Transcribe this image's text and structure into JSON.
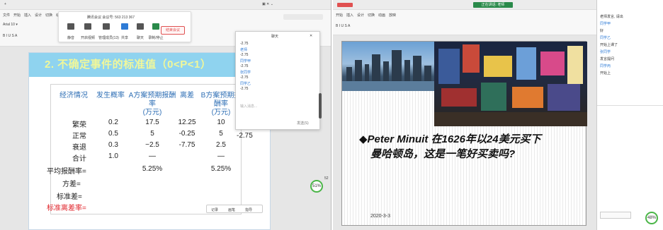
{
  "left": {
    "meeting": {
      "id_label": "腾讯会议  会议号: 563 213 367",
      "buttons": [
        "静音",
        "开启视频",
        "管理成员(13)",
        "共享",
        "聊天",
        "录制/停止",
        "更多"
      ],
      "end_label": "结束会议"
    },
    "slide": {
      "title": "2. 不确定事件的标准值（0<P<1）",
      "headers": {
        "h1": "经济情况",
        "h2": "发生概率",
        "h3_l1": "A方案预期报酬",
        "h3_l2": "率",
        "h3_l3": "(万元)",
        "h4": "离差",
        "h5_l1": "B方案预期报",
        "h5_l2": "酬率",
        "h5_l3": "(万元)"
      },
      "rows": [
        {
          "c1": "繁荣",
          "c2": "0.2",
          "c3": "17.5",
          "c4": "12.25",
          "c5": "10",
          "c6": ""
        },
        {
          "c1": "正常",
          "c2": "0.5",
          "c3": "5",
          "c4": "-0.25",
          "c5": "5",
          "c6": ""
        },
        {
          "c1": "衰退",
          "c2": "0.3",
          "c3": "−2.5",
          "c4": "-7.75",
          "c5": "2.5",
          "c6": "-2.75"
        },
        {
          "c1": "合计",
          "c2": "1.0",
          "c3": "—",
          "c4": "",
          "c5": "—",
          "c6": ""
        }
      ],
      "summary": {
        "avg_label": "平均报酬率=",
        "avg_a": "5.25%",
        "avg_b": "5.25%",
        "var_label": "方差=",
        "std_label": "标准差=",
        "cv_label": "标准离差率="
      }
    },
    "chat": {
      "title": "聊天",
      "lines": [
        "-2.75",
        "老师",
        "-2.75",
        "同学甲",
        "-2.75",
        "张同学",
        "-2.75",
        "同学乙",
        "-2.75"
      ],
      "input_placeholder": "输入消息...",
      "send_label": "发送(S)"
    },
    "badge": "51%",
    "badge_side": "52",
    "toolstrip": [
      "记录",
      "画笔",
      "指导"
    ]
  },
  "right": {
    "titlebar_badge": "正在讲话: 老师",
    "slide": {
      "text_line1": "◆Peter Minuit 在1626年以24美元买下",
      "text_line2": "曼哈顿岛，这是一笔好买卖吗?",
      "date": "2020-3-3"
    },
    "side": {
      "lines": [
        "老师发言, 请出",
        "同学甲",
        "好",
        "同学乙",
        "开始上课了",
        "张同学",
        "发言提问",
        "同学丙",
        "开始上"
      ],
      "badge": "48%"
    }
  },
  "colors": {
    "title_bar": "#8fd3ef",
    "title_text": "#f0f79a",
    "header_text": "#2f6fb5",
    "accent_red": "#e0232a",
    "wps_green": "#2a8a4a"
  }
}
